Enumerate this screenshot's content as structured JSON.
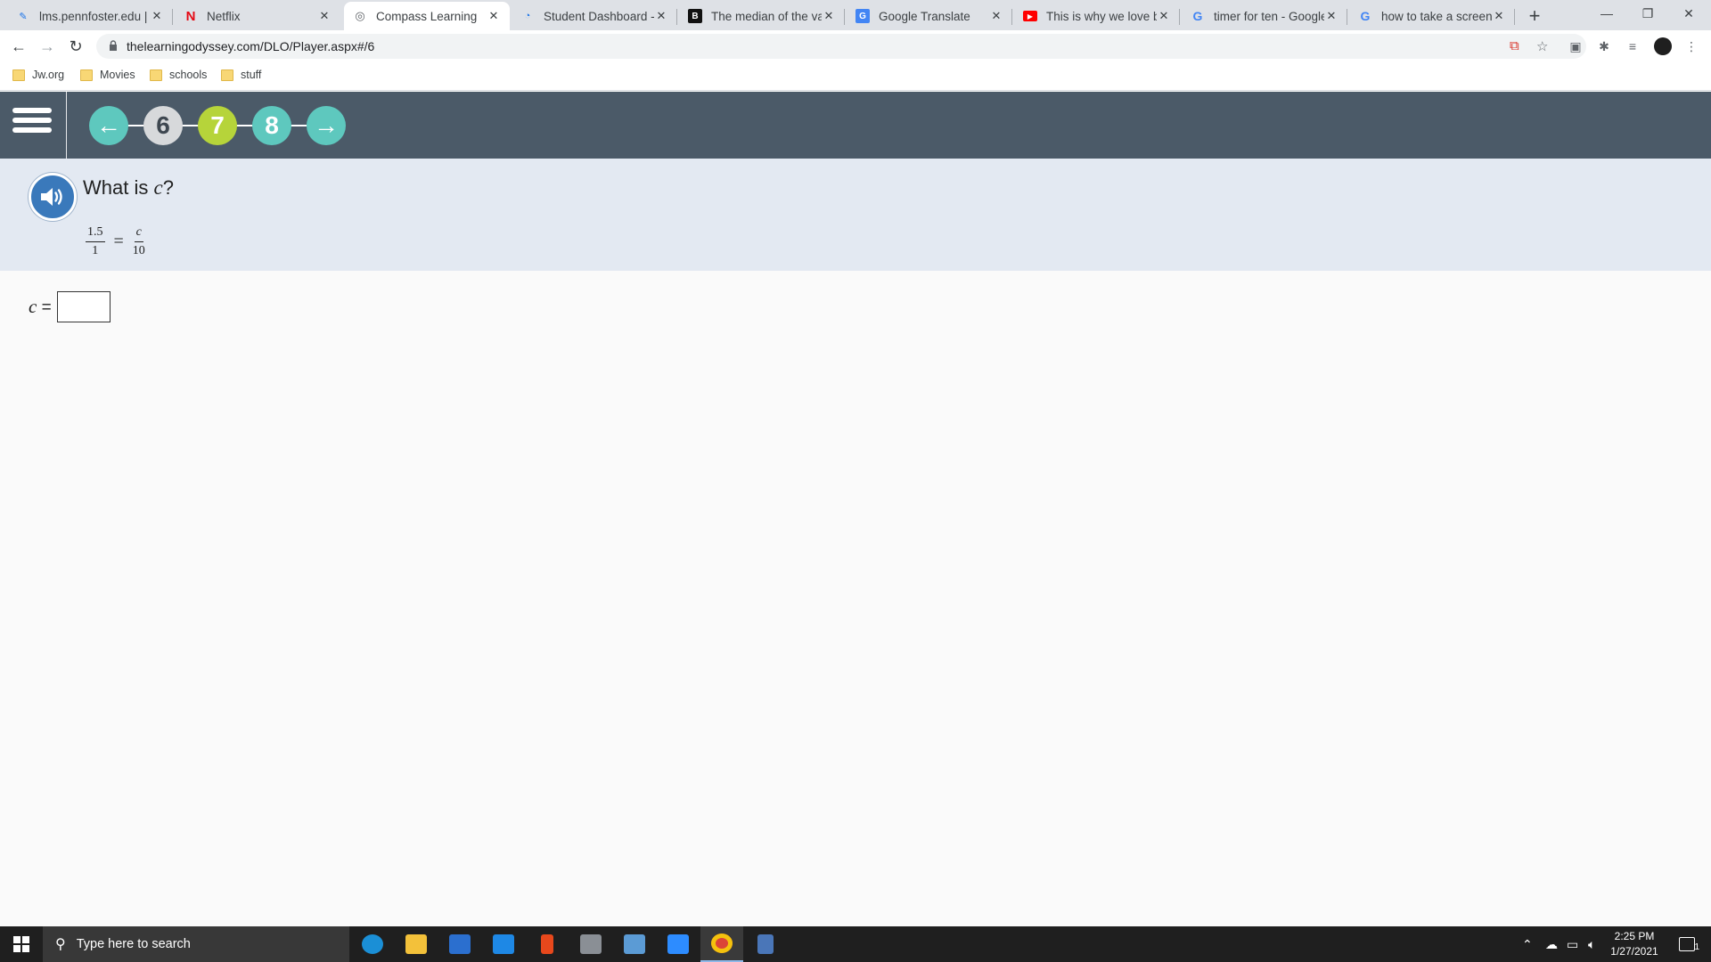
{
  "browser": {
    "tabs": [
      {
        "title": "lms.pennfoster.edu | H",
        "icon": "edit-icon",
        "active": false
      },
      {
        "title": "Netflix",
        "icon": "netflix-icon",
        "active": false
      },
      {
        "title": "Compass Learning",
        "icon": "globe-icon",
        "active": true
      },
      {
        "title": "Student Dashboard - Tr",
        "icon": "dashboard-icon",
        "active": false
      },
      {
        "title": "The median of the valu",
        "icon": "brainly-icon",
        "active": false
      },
      {
        "title": "Google Translate",
        "icon": "translate-icon",
        "active": false
      },
      {
        "title": "This is why we love bik",
        "icon": "youtube-icon",
        "active": false
      },
      {
        "title": "timer for ten - Google",
        "icon": "google-icon",
        "active": false
      },
      {
        "title": "how to take a screensh",
        "icon": "google-icon",
        "active": false
      }
    ],
    "url": "thelearningodyssey.com/DLO/Player.aspx#/6",
    "bookmarks": [
      "Jw.org",
      "Movies",
      "schools",
      "stuff"
    ]
  },
  "player": {
    "steps": [
      {
        "label": "6",
        "state": "visited"
      },
      {
        "label": "7",
        "state": "current"
      },
      {
        "label": "8",
        "state": "upcoming"
      }
    ],
    "prev_label": "←",
    "next_label": "→"
  },
  "question": {
    "prefix": "What is ",
    "variable": "c",
    "suffix": "?",
    "equation": {
      "left_num": "1.5",
      "left_den": "1",
      "equals": "=",
      "right_num": "c",
      "right_den": "10"
    },
    "answer_label_var": "c",
    "answer_label_eq": " =",
    "answer_value": ""
  },
  "taskbar": {
    "search_placeholder": "Type here to search",
    "time": "2:25 PM",
    "date": "1/27/2021",
    "notification_count": "1"
  },
  "colors": {
    "header": "#4b5a68",
    "question_band": "#e3e9f2",
    "step_current": "#b6d43a",
    "step_upcoming": "#5ec8be",
    "audio": "#3a79bb"
  }
}
